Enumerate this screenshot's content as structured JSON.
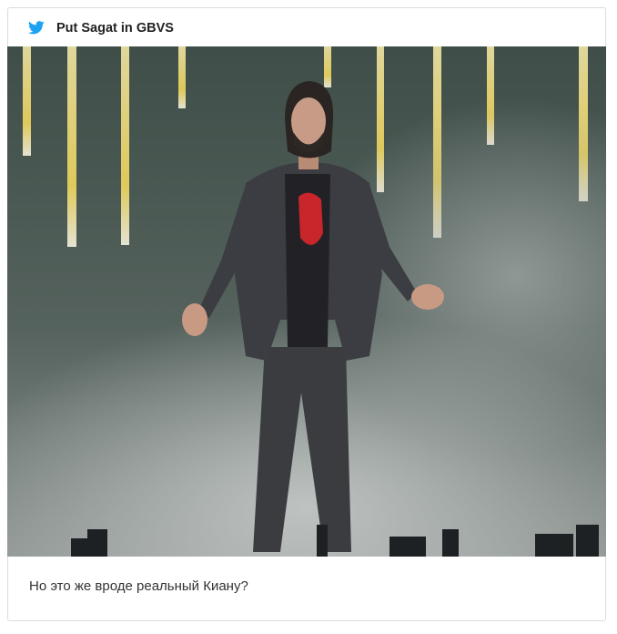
{
  "tweet": {
    "author": "Put Sagat in GBVS",
    "caption": "Но это же вроде реальный Киану?",
    "icon": "twitter-bird-icon",
    "accent": "#1da1f2"
  },
  "media": {
    "description_colors": {
      "stage_background": "#4a5a53",
      "fog": "#8f9a97",
      "suit": "#3a3a3e",
      "shirt_graphic": "#c8262a"
    }
  }
}
